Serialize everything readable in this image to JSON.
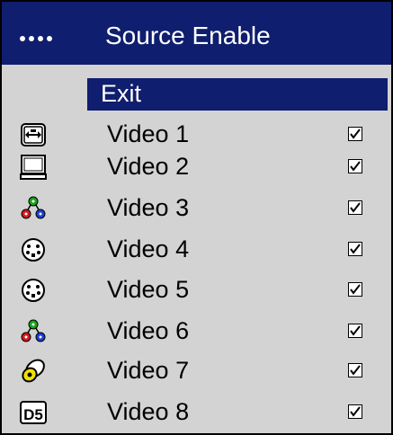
{
  "menu": {
    "title": "Source Enable",
    "exit_label": "Exit",
    "items": [
      {
        "label": "Video 1",
        "icon": "computer-port-icon",
        "enabled": true
      },
      {
        "label": "Video 2",
        "icon": "monitor-icon",
        "enabled": true
      },
      {
        "label": "Video 3",
        "icon": "component-rgb-icon",
        "enabled": true
      },
      {
        "label": "Video 4",
        "icon": "s-video-icon",
        "enabled": true
      },
      {
        "label": "Video 5",
        "icon": "s-video-icon",
        "enabled": true
      },
      {
        "label": "Video 6",
        "icon": "component-rgb-icon",
        "enabled": true
      },
      {
        "label": "Video 7",
        "icon": "composite-video-icon",
        "enabled": true
      },
      {
        "label": "Video 8",
        "icon": "d5-icon",
        "enabled": true
      }
    ],
    "d5_text": "D5"
  },
  "colors": {
    "title_bg": "#0f1e6e",
    "panel_bg": "#d3d3d3",
    "text": "#000000",
    "title_text": "#ffffff"
  }
}
